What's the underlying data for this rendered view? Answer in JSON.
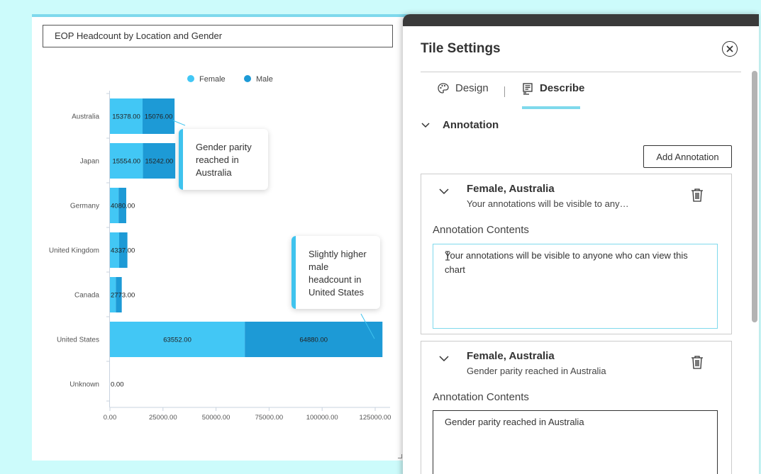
{
  "chart": {
    "title": "EOP Headcount by Location and Gender",
    "annotation_1": "Gender parity reached in Australia",
    "annotation_2": "Slightly higher male headcount in United States"
  },
  "chart_data": {
    "type": "bar",
    "orientation": "horizontal",
    "stacked": true,
    "categories": [
      "Australia",
      "Japan",
      "Germany",
      "United Kingdom",
      "Canada",
      "United States",
      "Unknown"
    ],
    "series": [
      {
        "name": "Female",
        "values": [
          15378,
          15554,
          4080,
          4337,
          2773,
          63552,
          0
        ],
        "color": "#42c7f5"
      },
      {
        "name": "Male",
        "values": [
          15076,
          15242,
          3600,
          3900,
          2800,
          64880,
          0
        ],
        "color": "#1d9ad6"
      }
    ],
    "data_labels": [
      "15378.00",
      "15076.00",
      "15554.00",
      "15242.00",
      "4080.00",
      "4337.00",
      "2773.00",
      "63552.00",
      "64880.00",
      "0.00"
    ],
    "x_ticks": [
      "0.00",
      "25000.00",
      "50000.00",
      "75000.00",
      "100000.00",
      "125000.00"
    ],
    "xlim": [
      0,
      135000
    ],
    "legend": "top-center",
    "grid": false
  },
  "panel": {
    "title": "Tile Settings",
    "tabs": {
      "design": "Design",
      "describe": "Describe"
    },
    "section": "Annotation",
    "add_button": "Add Annotation",
    "cards": [
      {
        "title": "Female, Australia",
        "subtitle": "Your annotations will be visible to any…",
        "label": "Annotation Contents",
        "content": "Your annotations will be visible to anyone who can view this chart"
      },
      {
        "title": "Female, Australia",
        "subtitle": "Gender parity reached in Australia",
        "label": "Annotation Contents",
        "content": "Gender parity reached in Australia"
      }
    ]
  },
  "colors": {
    "accent": "#7fd9ec",
    "female": "#42c7f5",
    "male": "#1d9ad6",
    "background": "#ccfbfb"
  }
}
